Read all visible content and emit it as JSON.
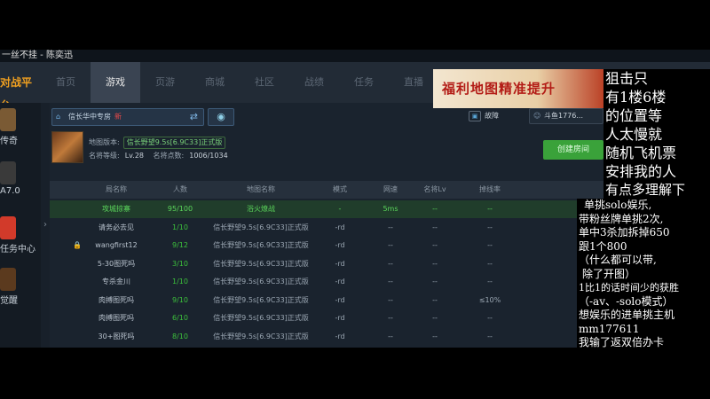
{
  "window": {
    "title": "一丝不挂 - 陈奕迅"
  },
  "nav": {
    "logo": "对战平台",
    "tabs": [
      "首页",
      "游戏",
      "页游",
      "商城",
      "社区",
      "战绩",
      "任务",
      "直播"
    ],
    "active_tab": "游戏",
    "banner_text": "福利地图精准提升"
  },
  "sidebar": {
    "items": [
      {
        "label": "传奇",
        "color": "#7a5a34"
      },
      {
        "label": "A7.0",
        "color": "#3a3a3a"
      },
      {
        "label": "任务中心",
        "color": "#d23a2a"
      },
      {
        "label": "觉醒",
        "color": "#5b3a1e"
      }
    ]
  },
  "room": {
    "name": "信长华中专房",
    "tag": "新",
    "cpu_label": "故障",
    "user_label": "斗鱼1776..."
  },
  "map_info": {
    "version_label": "地图版本:",
    "version_value": "信长野望9.5s[6.9C33]正式版",
    "rank_label": "名将等级:",
    "rank_value": "Lv.28",
    "points_label": "名将点数:",
    "points_value": "1006/1034",
    "create_button": "创建房间"
  },
  "table": {
    "columns": [
      "局名称",
      "人数",
      "地图名称",
      "模式",
      "网速",
      "名将Lv",
      "掉线率"
    ],
    "rows": [
      {
        "name": "攻城掠寨",
        "players": "95/100",
        "map": "浴火燎战",
        "mode": "-",
        "ping": "5ms",
        "lv": "--",
        "drop": "--",
        "selected": true,
        "locked": false
      },
      {
        "name": "请务必去见",
        "players": "1/10",
        "map": "信长野望9.5s[6.9C33]正式版",
        "mode": "-rd",
        "ping": "--",
        "lv": "--",
        "drop": "--",
        "selected": false,
        "locked": false
      },
      {
        "name": "wangfirst12",
        "players": "9/12",
        "map": "信长野望9.5s[6.9C33]正式版",
        "mode": "-rd",
        "ping": "--",
        "lv": "--",
        "drop": "--",
        "selected": false,
        "locked": true
      },
      {
        "name": "5-30图死吗",
        "players": "3/10",
        "map": "信长野望9.5s[6.9C33]正式版",
        "mode": "-rd",
        "ping": "--",
        "lv": "--",
        "drop": "--",
        "selected": false,
        "locked": false
      },
      {
        "name": "专杀金川",
        "players": "1/10",
        "map": "信长野望9.5s[6.9C33]正式版",
        "mode": "-rd",
        "ping": "--",
        "lv": "--",
        "drop": "--",
        "selected": false,
        "locked": false
      },
      {
        "name": "肉搏图死吗",
        "players": "9/10",
        "map": "信长野望9.5s[6.9C33]正式版",
        "mode": "-rd",
        "ping": "--",
        "lv": "--",
        "drop": "≤10%",
        "selected": false,
        "locked": false
      },
      {
        "name": "肉搏图死吗",
        "players": "6/10",
        "map": "信长野望9.5s[6.9C33]正式版",
        "mode": "-rd",
        "ping": "--",
        "lv": "--",
        "drop": "--",
        "selected": false,
        "locked": false
      },
      {
        "name": "30+图死吗",
        "players": "8/10",
        "map": "信长野望9.5s[6.9C33]正式版",
        "mode": "-rd",
        "ping": "--",
        "lv": "--",
        "drop": "--",
        "selected": false,
        "locked": false
      }
    ]
  },
  "overlay": {
    "top_lines": [
      "狙击只",
      "有1楼6楼",
      "的位置等",
      "人太慢就",
      "随机飞机票",
      "安排我的人",
      "有点多理解下"
    ],
    "bottom_lines": [
      "单挑solo娱乐,",
      "带粉丝牌单挑2次,",
      "单中3杀加拆掉650",
      "跟1个800",
      "（什么都可以带,",
      "除了开图）",
      "1比1的话时间少的获胜",
      "（-av、-solo模式）",
      "想娱乐的进单挑主机",
      "mm177611",
      "我输了返双倍办卡"
    ]
  }
}
